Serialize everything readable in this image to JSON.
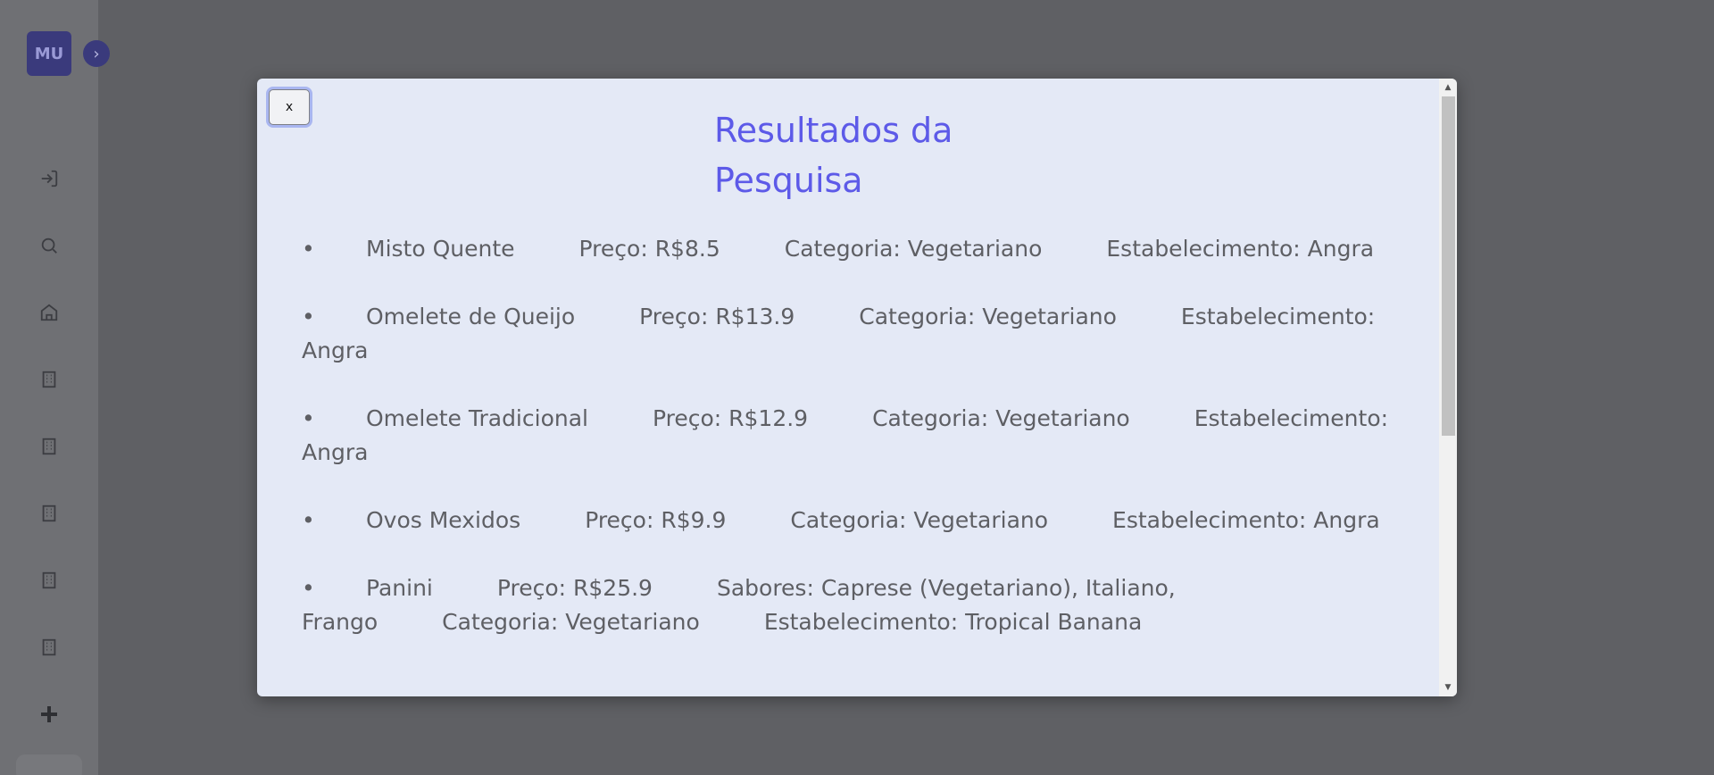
{
  "sidebar": {
    "avatar_initials": "MU",
    "expand_glyph": "›",
    "icons": [
      "login-icon",
      "search-icon",
      "home-icon",
      "building-icon",
      "building-icon",
      "building-icon",
      "building-icon",
      "building-icon",
      "plus-icon"
    ]
  },
  "modal": {
    "close_label": "x",
    "title": "Resultados da Pesquisa",
    "results": [
      {
        "nome": "Misto Quente",
        "preco": "Preço: R$8.5",
        "categoria": "Categoria: Vegetariano",
        "estabelecimento": "Estabelecimento: Angra"
      },
      {
        "nome": "Omelete de Queijo",
        "preco": "Preço: R$13.9",
        "categoria": "Categoria: Vegetariano",
        "estabelecimento": "Estabelecimento: Angra"
      },
      {
        "nome": "Omelete Tradicional",
        "preco": "Preço: R$12.9",
        "categoria": "Categoria: Vegetariano",
        "estabelecimento": "Estabelecimento: Angra"
      },
      {
        "nome": "Ovos Mexidos",
        "preco": "Preço: R$9.9",
        "categoria": "Categoria: Vegetariano",
        "estabelecimento": "Estabelecimento: Angra"
      },
      {
        "nome": "Panini",
        "preco": "Preço: R$25.9",
        "sabores": "Sabores: Caprese (Vegetariano), Italiano, Frango",
        "categoria": "Categoria: Vegetariano",
        "estabelecimento": "Estabelecimento: Tropical Banana"
      }
    ]
  },
  "colors": {
    "accent": "#5d5ae8",
    "modal_bg": "#e4e9f6",
    "text": "#5e5f64",
    "overlay": "#5f6064"
  }
}
